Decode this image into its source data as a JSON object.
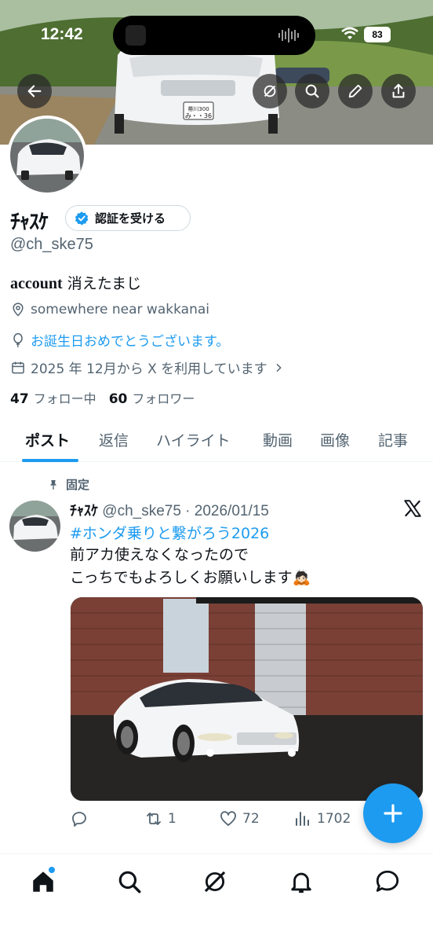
{
  "status_bar": {
    "time": "12:42",
    "battery": "83"
  },
  "banner": {
    "plate_text": "帯川300\nみ・・36"
  },
  "profile": {
    "name": "ﾁｬｽｹ",
    "verify_label": "認証を受ける",
    "handle": "@ch_ske75",
    "bio_en": "account",
    "bio_ja": " 消えたまじ",
    "location": "somewhere near wakkanai",
    "birthday": "お誕生日おめでとうございます。",
    "joined": "2025 年 12月から X を利用しています",
    "following_count": "47",
    "following_label": "フォロー中",
    "followers_count": "60",
    "followers_label": "フォロワー"
  },
  "tabs": [
    "ポスト",
    "返信",
    "ハイライト",
    "動画",
    "画像",
    "記事"
  ],
  "post": {
    "pinned_label": "固定",
    "author": "ﾁｬｽｹ",
    "handle_date": " @ch_ske75 · 2026/01/15",
    "hashtag": "#ホンダ乗りと繋がろう2026",
    "line1": "前アカ使えなくなったので",
    "line2": "こっちでもよろしくお願いします🙇🏻",
    "retweets": "1",
    "likes": "72",
    "views": "1702"
  },
  "colors": {
    "accent": "#1d9bf0",
    "text": "#0f1419",
    "muted": "#536471"
  },
  "icons": {
    "back": "arrow-left-icon",
    "grok": "grok-icon",
    "search": "search-icon",
    "edit": "pencil-icon",
    "share": "share-icon",
    "verify": "verified-badge-icon",
    "location": "location-pin-icon",
    "birthday": "balloon-icon",
    "calendar": "calendar-icon",
    "pin": "pin-icon",
    "x": "x-logo-icon",
    "reply": "reply-icon",
    "retweet": "retweet-icon",
    "like": "heart-icon",
    "views": "views-icon",
    "compose": "plus-icon",
    "home": "home-icon",
    "explore": "search-icon",
    "grok_nav": "grok-icon",
    "notifications": "bell-icon",
    "messages": "message-icon"
  }
}
